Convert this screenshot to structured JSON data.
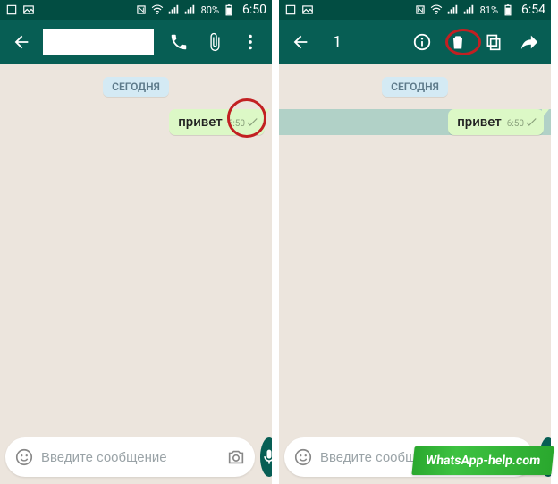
{
  "left": {
    "statusbar": {
      "battery": "80%",
      "time": "6:50"
    },
    "appbar": {
      "contact_name": ""
    },
    "chat": {
      "date_label": "СЕГОДНЯ",
      "message": {
        "text": "привет",
        "time": "6:50"
      }
    },
    "input": {
      "placeholder": "Введите сообщение"
    }
  },
  "right": {
    "statusbar": {
      "battery": "81%",
      "time": "6:54"
    },
    "appbar": {
      "selected_count": "1"
    },
    "chat": {
      "date_label": "СЕГОДНЯ",
      "message": {
        "text": "привет",
        "time": "6:50"
      }
    },
    "input": {
      "placeholder": "Введите сообщение"
    }
  },
  "watermark": "WhatsApp-help.com"
}
